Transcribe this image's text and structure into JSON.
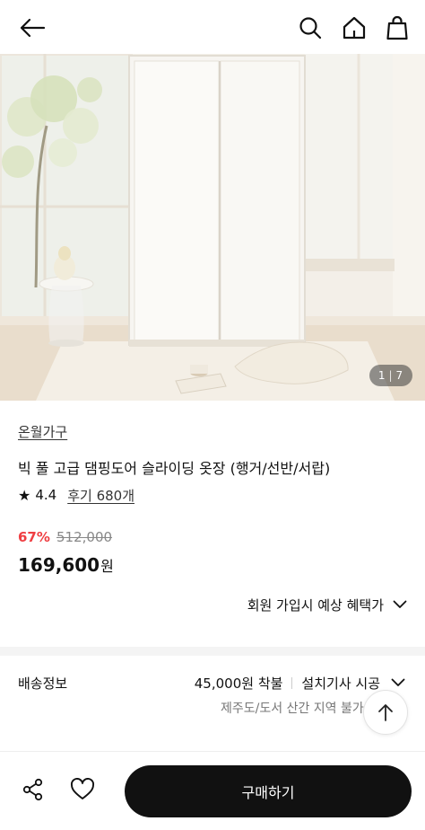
{
  "header": {
    "back_icon": "arrow-left-icon",
    "search_icon": "search-icon",
    "home_icon": "home-icon",
    "cart_icon": "shopping-bag-icon"
  },
  "gallery": {
    "current": "1",
    "total": "7"
  },
  "product": {
    "brand": "온월가구",
    "title": "빅 풀 고급 댐핑도어 슬라이딩 옷장 (행거/선반/서랍)",
    "rating": "4.4",
    "review_link": "후기 680개",
    "discount": "67%",
    "original_price": "512,000",
    "price": "169,600",
    "price_unit": "원",
    "member_benefit": "회원 가입시 예상 혜택가",
    "accent_color": "#ef3e42"
  },
  "shipping": {
    "label": "배송정보",
    "fee": "45,000원 착불",
    "method": "설치기사 시공",
    "note": "제주도/도서 산간 지역 불가"
  },
  "bottom_bar": {
    "share_icon": "share-icon",
    "like_icon": "heart-icon",
    "buy_label": "구매하기",
    "scroll_top_icon": "arrow-up-icon"
  }
}
